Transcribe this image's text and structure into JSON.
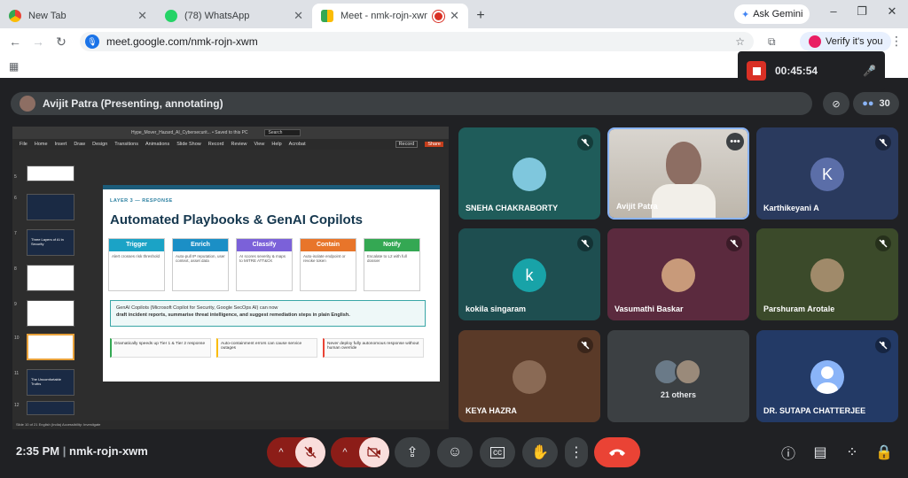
{
  "browser": {
    "tabs": [
      {
        "title": "New Tab"
      },
      {
        "title": "(78) WhatsApp"
      },
      {
        "title": "Meet - nmk-rojn-xwm"
      }
    ],
    "gemini_label": "Ask Gemini",
    "url": "meet.google.com/nmk-rojn-xwm",
    "verify_label": "Verify it's you"
  },
  "recording": {
    "timer": "00:45:54"
  },
  "presenter_bar": {
    "label": "Avijit Patra (Presenting, annotating)"
  },
  "participant_count": "30",
  "presentation": {
    "ppt_title": "Hype_Mover_Hazard_AI_Cybersecurit... • Saved to this PC",
    "search": "Search",
    "menu": [
      "File",
      "Home",
      "Insert",
      "Draw",
      "Design",
      "Transitions",
      "Animations",
      "Slide Show",
      "Record",
      "Review",
      "View",
      "Help",
      "Acrobat"
    ],
    "record_btn": "Record",
    "share_btn": "Share",
    "thumb_numbers": [
      "5",
      "6",
      "7",
      "8",
      "9",
      "10",
      "11",
      "12"
    ],
    "thumb_titles": {
      "t7": "Three Layers of AI in Security",
      "t11": "The Uncomfortable Truths"
    },
    "slide": {
      "layer": "LAYER 3 — RESPONSE",
      "title": "Automated Playbooks & GenAI Copilots",
      "steps": [
        {
          "title": "Trigger",
          "text": "Alert crosses risk threshold",
          "color": "#1ba3c6"
        },
        {
          "title": "Enrich",
          "text": "Auto-pull IP reputation, user context, asset data",
          "color": "#1b8fc6"
        },
        {
          "title": "Classify",
          "text": "AI scores severity & maps to MITRE ATT&CK",
          "color": "#7b61d9"
        },
        {
          "title": "Contain",
          "text": "Auto-isolate endpoint or revoke token",
          "color": "#e8752a"
        },
        {
          "title": "Notify",
          "text": "Escalate to L2 with full dossier",
          "color": "#34a853"
        }
      ],
      "callout_1": "GenAI Copilots (Microsoft Copilot for Security, Google SecOps AI) can now",
      "callout_2": "draft incident reports, summarise threat intelligence, and suggest remediation steps in plain English.",
      "chips": [
        "Dramatically speeds up Tier 1 & Tier 2 response",
        "Auto-containment errors can cause service outages",
        "Never deploy fully autonomous response without human override"
      ]
    },
    "status": "Slide 10 of 21   English (India)   Accessibility: Investigate"
  },
  "participants": [
    {
      "name": "SNEHA CHAKRABORTY",
      "bg": "#1f5c5a",
      "avatar_type": "pic",
      "avatar_color": "#7fc7dd"
    },
    {
      "name": "Avijit Patra",
      "bg": "#cfcfcf",
      "avatar_type": "video",
      "avatar_color": "#8d6e63"
    },
    {
      "name": "Karthikeyani A",
      "bg": "#2a3a5e",
      "avatar_type": "letter",
      "letter": "K",
      "avatar_color": "#5b6ea8"
    },
    {
      "name": "kokila singaram",
      "bg": "#1e4e50",
      "avatar_type": "letter",
      "letter": "k",
      "avatar_color": "#18a3a8"
    },
    {
      "name": "Vasumathi Baskar",
      "bg": "#5b2a3e",
      "avatar_type": "pic",
      "avatar_color": "#c89a7a"
    },
    {
      "name": "Parshuram Arotale",
      "bg": "#3b4a2a",
      "avatar_type": "pic",
      "avatar_color": "#a08a6a"
    },
    {
      "name": "KEYA HAZRA",
      "bg": "#5a3a28",
      "avatar_type": "pic",
      "avatar_color": "#8a6a55"
    },
    {
      "name": "21 others",
      "bg": "#3c4043",
      "avatar_type": "group",
      "avatar_color": "#9a9a9a"
    },
    {
      "name": "DR. SUTAPA CHATTERJEE",
      "bg": "#233a66",
      "avatar_type": "person",
      "avatar_color": "#8ab4f8"
    }
  ],
  "bottom": {
    "time": "2:35 PM",
    "meeting_code": "nmk-rojn-xwm"
  }
}
